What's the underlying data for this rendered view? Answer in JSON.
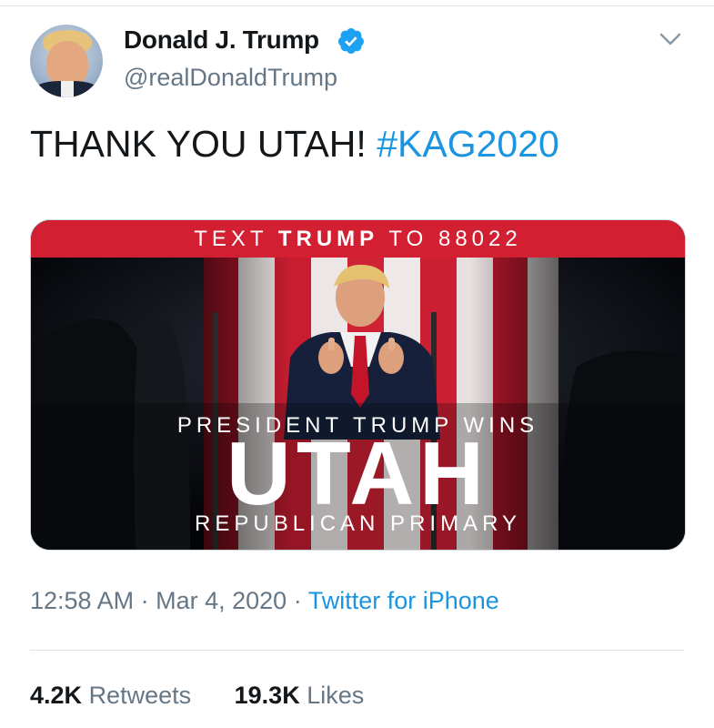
{
  "author": {
    "display_name": "Donald J. Trump",
    "handle": "@realDonaldTrump",
    "verified_icon": "verified-badge-icon",
    "avatar_icon": "profile-photo"
  },
  "menu": {
    "icon": "chevron-down-icon"
  },
  "tweet": {
    "text": "THANK YOU UTAH!",
    "hashtag": "#KAG2020"
  },
  "media": {
    "banner_prefix": "TEXT",
    "banner_bold": "TRUMP",
    "banner_suffix": "TO 88022",
    "headline_top": "PRESIDENT TRUMP WINS",
    "headline_main": "UTAH",
    "headline_bottom": "REPUBLICAN PRIMARY"
  },
  "meta": {
    "time": "12:58 AM",
    "separator": "·",
    "date": "Mar 4, 2020",
    "separator2": "·",
    "source": "Twitter for iPhone"
  },
  "stats": {
    "retweets_count": "4.2K",
    "retweets_label": "Retweets",
    "likes_count": "19.3K",
    "likes_label": "Likes"
  },
  "colors": {
    "link_blue": "#1b95e0",
    "banner_red": "#d21f32",
    "muted_gray": "#657786"
  }
}
